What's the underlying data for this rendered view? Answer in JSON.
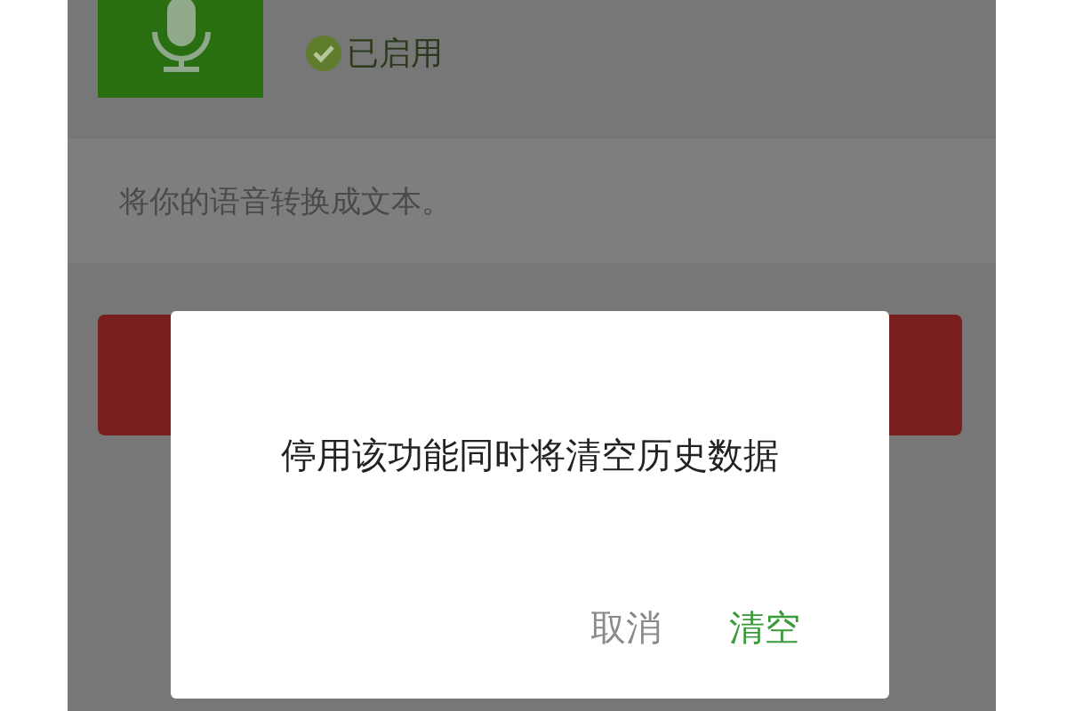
{
  "feature": {
    "status": "已启用",
    "enabled": true,
    "description": "将你的语音转换成文本。"
  },
  "dialog": {
    "message": "停用该功能同时将清空历史数据",
    "buttons": [
      {
        "label": "取消",
        "kind": "cancel"
      },
      {
        "label": "清空",
        "kind": "confirm"
      }
    ]
  }
}
